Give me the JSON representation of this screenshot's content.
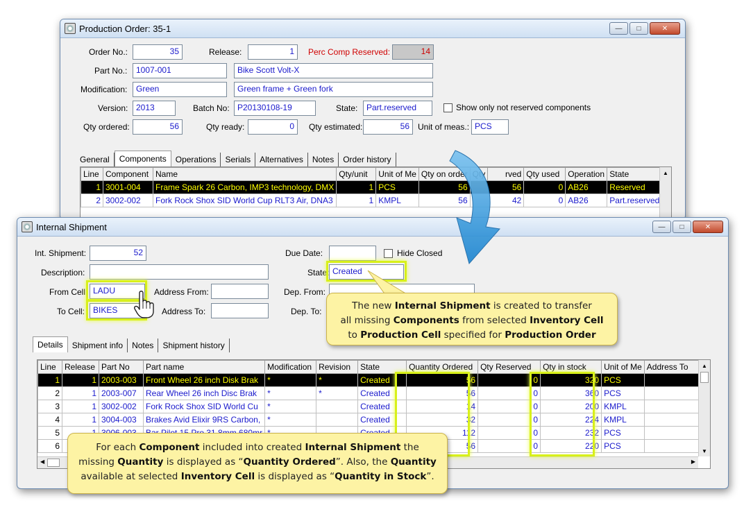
{
  "production_order": {
    "title": "Production Order: 35-1",
    "order_no_label": "Order No.:",
    "order_no": "35",
    "release_label": "Release:",
    "release": "1",
    "perc_comp_reserved_label": "Perc Comp Reserved:",
    "perc_comp_reserved": "14",
    "part_no_label": "Part No.:",
    "part_no": "1007-001",
    "part_name": "Bike Scott Volt-X",
    "modification_label": "Modification:",
    "modification": "Green",
    "modification_desc": "Green frame + Green fork",
    "version_label": "Version:",
    "version": "2013",
    "batch_no_label": "Batch No:",
    "batch_no": "P20130108-19",
    "state_label": "State:",
    "state": "Part.reserved",
    "show_not_reserved_label": "Show only not reserved components",
    "qty_ordered_label": "Qty ordered:",
    "qty_ordered": "56",
    "qty_ready_label": "Qty ready:",
    "qty_ready": "0",
    "qty_estimated_label": "Qty estimated:",
    "qty_estimated": "56",
    "unit_of_meas_label": "Unit of meas.:",
    "unit_of_meas": "PCS",
    "tabs": [
      "General",
      "Components",
      "Operations",
      "Serials",
      "Alternatives",
      "Notes",
      "Order history"
    ],
    "grid_headers": [
      "Line",
      "Component",
      "Name",
      "Qty/unit",
      "Unit of Me",
      "Qty on order",
      "Qty",
      "rved",
      "Qty used",
      "Operation",
      "State"
    ],
    "rows": [
      {
        "line": "1",
        "component": "3001-004",
        "name": "Frame Spark 26 Carbon, IMP3 technology, DMX",
        "qty_unit": "1",
        "unit": "PCS",
        "qty_on_order": "56",
        "qty_reserved": "56",
        "qty_used": "0",
        "operation": "AB26",
        "state": "Reserved"
      },
      {
        "line": "2",
        "component": "3002-002",
        "name": "Fork Rock Shox SID World Cup RLT3 Air, DNA3",
        "qty_unit": "1",
        "unit": "KMPL",
        "qty_on_order": "56",
        "qty_reserved": "42",
        "qty_used": "0",
        "operation": "AB26",
        "state": "Part.reserved"
      }
    ]
  },
  "internal_shipment": {
    "title": "Internal Shipment",
    "int_shipment_label": "Int. Shipment:",
    "int_shipment": "52",
    "due_date_label": "Due Date:",
    "due_date": "",
    "hide_closed_label": "Hide Closed",
    "description_label": "Description:",
    "description": "",
    "state_label": "State:",
    "state": "Created",
    "from_cell_label": "From Cell:",
    "from_cell": "LADU",
    "address_from_label": "Address From:",
    "address_from": "",
    "dep_from_label": "Dep. From:",
    "to_cell_label": "To Cell:",
    "to_cell": "BIKES",
    "address_to_label": "Address To:",
    "address_to": "",
    "dep_to_label": "Dep. To:",
    "tabs": [
      "Details",
      "Shipment info",
      "Notes",
      "Shipment history"
    ],
    "grid_headers": [
      "Line",
      "Release",
      "Part No",
      "Part name",
      "Modification",
      "Revision",
      "State",
      "Quantity Ordered",
      "Qty Reserved",
      "Qty in stock",
      "Unit of Me",
      "Address To"
    ],
    "rows": [
      {
        "line": "1",
        "release": "1",
        "part_no": "2003-003",
        "part_name": "Front Wheel 26 inch Disk Brak",
        "modification": "*",
        "revision": "*",
        "state": "Created",
        "qty_ordered": "56",
        "qty_reserved": "0",
        "qty_in_stock": "320",
        "unit": "PCS",
        "address_to": ""
      },
      {
        "line": "2",
        "release": "1",
        "part_no": "2003-007",
        "part_name": "Rear Wheel 26 inch Disc Brak",
        "modification": "*",
        "revision": "*",
        "state": "Created",
        "qty_ordered": "56",
        "qty_reserved": "0",
        "qty_in_stock": "360",
        "unit": "PCS",
        "address_to": ""
      },
      {
        "line": "3",
        "release": "1",
        "part_no": "3002-002",
        "part_name": "Fork Rock Shox SID World Cu",
        "modification": "*",
        "revision": "",
        "state": "Created",
        "qty_ordered": "14",
        "qty_reserved": "0",
        "qty_in_stock": "200",
        "unit": "KMPL",
        "address_to": ""
      },
      {
        "line": "4",
        "release": "1",
        "part_no": "3004-003",
        "part_name": "Brakes Avid Elixir 9RS Carbon,",
        "modification": "*",
        "revision": "",
        "state": "Created",
        "qty_ordered": "32",
        "qty_reserved": "0",
        "qty_in_stock": "224",
        "unit": "KMPL",
        "address_to": ""
      },
      {
        "line": "5",
        "release": "1",
        "part_no": "3006-003",
        "part_name": "Bar Pilot 15 Pro 31.8mm 680mr",
        "modification": "*",
        "revision": "",
        "state": "Created",
        "qty_ordered": "112",
        "qty_reserved": "0",
        "qty_in_stock": "232",
        "unit": "PCS",
        "address_to": ""
      },
      {
        "line": "6",
        "release": "",
        "part_no": "",
        "part_name": "",
        "modification": "",
        "revision": "",
        "state": "",
        "qty_ordered": "56",
        "qty_reserved": "0",
        "qty_in_stock": "220",
        "unit": "PCS",
        "address_to": ""
      }
    ]
  },
  "callouts": {
    "shipment_created_parts": [
      "The new ",
      "Internal Shipment",
      " is created to transfer",
      "all missing ",
      "Components",
      " from selected ",
      "Inventory Cell",
      "to ",
      "Production  Cell",
      " specified for ",
      "Production Order"
    ],
    "quantities_parts": [
      "For each ",
      "Component",
      " included into created ",
      "Internal Shipment",
      " the",
      "missing ",
      "Quantity",
      " is displayed as “",
      "Quantity Ordered",
      "”. Also, the ",
      "Quantity",
      "available at selected ",
      "Inventory Cell",
      " is displayed as “",
      "Quantity in Stock",
      "”."
    ]
  },
  "colors": {
    "highlight": "#d8f01a",
    "callout_bg": "#fdf3a4",
    "selected_row_text": "#ffff00",
    "value_text": "#1a1acc"
  }
}
